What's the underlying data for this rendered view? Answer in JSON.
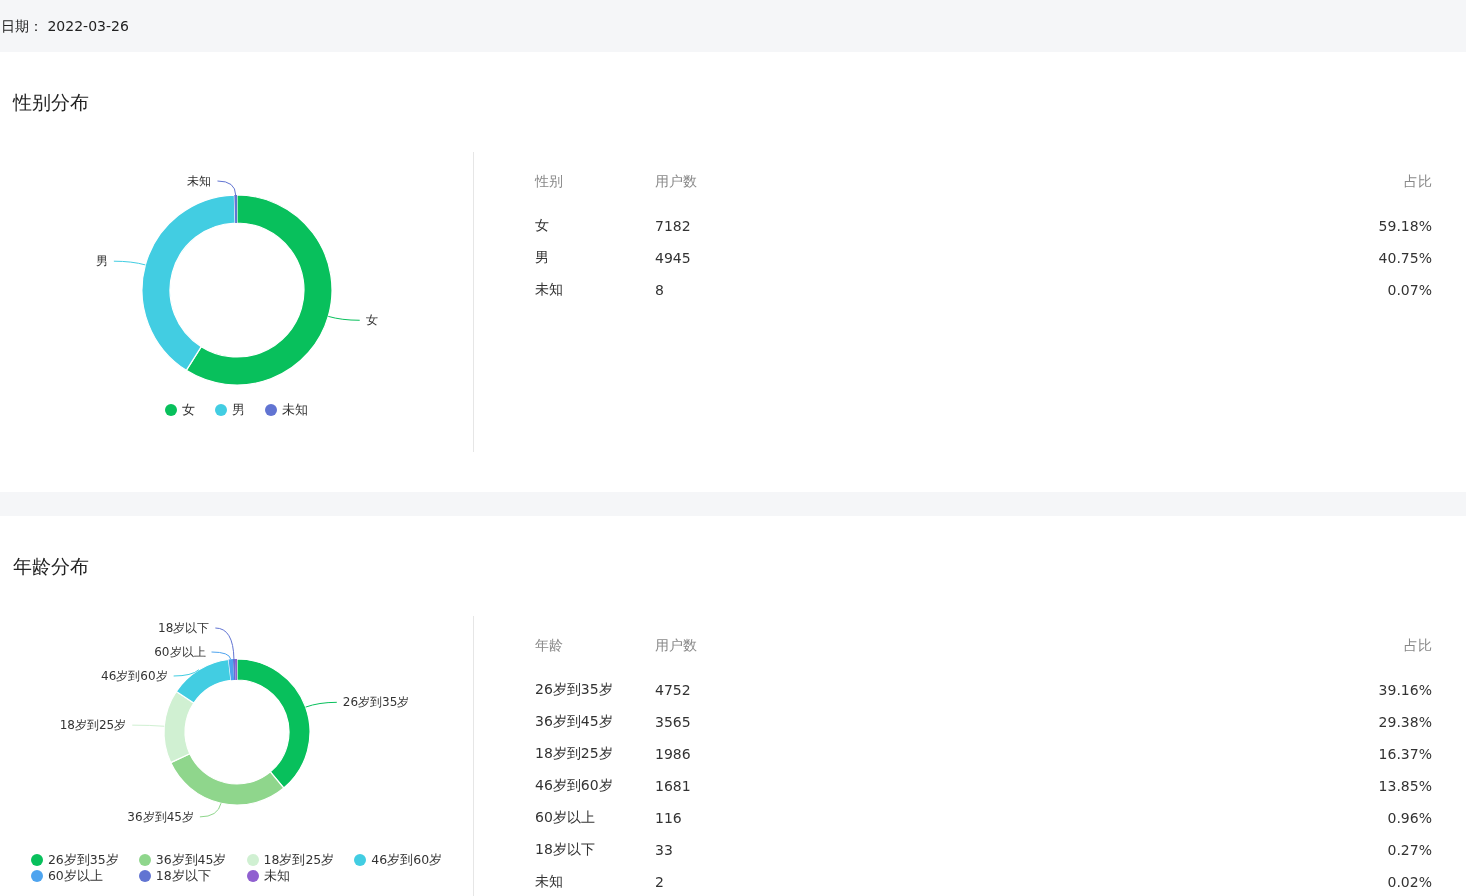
{
  "date": {
    "label": "日期：",
    "value": "2022-03-26"
  },
  "sections": [
    {
      "title": "性别分布",
      "chart_data": {
        "type": "donut",
        "categories": [
          "女",
          "男",
          "未知"
        ],
        "values": [
          59.18,
          40.75,
          0.07
        ],
        "legend": "bottom",
        "annotations": [
          {
            "text": "女"
          },
          {
            "text": "男"
          },
          {
            "text": "未知"
          }
        ]
      },
      "slice_colors": [
        {
          "color": "#08c05c"
        },
        {
          "color": "#42cde2"
        },
        {
          "color": "#6174d2"
        }
      ],
      "table": {
        "columns": [
          "性别",
          "用户数",
          "占比"
        ],
        "rows": [
          [
            "女",
            "7182",
            "59.18%"
          ],
          [
            "男",
            "4945",
            "40.75%"
          ],
          [
            "未知",
            "8",
            "0.07%"
          ]
        ]
      }
    },
    {
      "title": "年龄分布",
      "chart_data": {
        "type": "donut",
        "categories": [
          "26岁到35岁",
          "36岁到45岁",
          "18岁到25岁",
          "46岁到60岁",
          "60岁以上",
          "18岁以下",
          "未知"
        ],
        "values": [
          39.16,
          29.38,
          16.37,
          13.85,
          0.96,
          0.27,
          0.02
        ],
        "legend": "bottom",
        "annotations": [
          {
            "text": "26岁到35岁"
          },
          {
            "text": "36岁到45岁"
          },
          {
            "text": "18岁到25岁"
          },
          {
            "text": "46岁到60岁"
          },
          {
            "text": "60岁以上"
          },
          {
            "text": "18岁以下"
          }
        ]
      },
      "slice_colors": [
        {
          "color": "#08c05c"
        },
        {
          "color": "#8fd68c"
        },
        {
          "color": "#d0f0d2"
        },
        {
          "color": "#42cde2"
        },
        {
          "color": "#4ea4ef"
        },
        {
          "color": "#6174d2"
        },
        {
          "color": "#9060d0"
        }
      ],
      "table": {
        "columns": [
          "年龄",
          "用户数",
          "占比"
        ],
        "rows": [
          [
            "26岁到35岁",
            "4752",
            "39.16%"
          ],
          [
            "36岁到45岁",
            "3565",
            "29.38%"
          ],
          [
            "18岁到25岁",
            "1986",
            "16.37%"
          ],
          [
            "46岁到60岁",
            "1681",
            "13.85%"
          ],
          [
            "60岁以上",
            "116",
            "0.96%"
          ],
          [
            "18岁以下",
            "33",
            "0.27%"
          ],
          [
            "未知",
            "2",
            "0.02%"
          ]
        ]
      }
    }
  ]
}
